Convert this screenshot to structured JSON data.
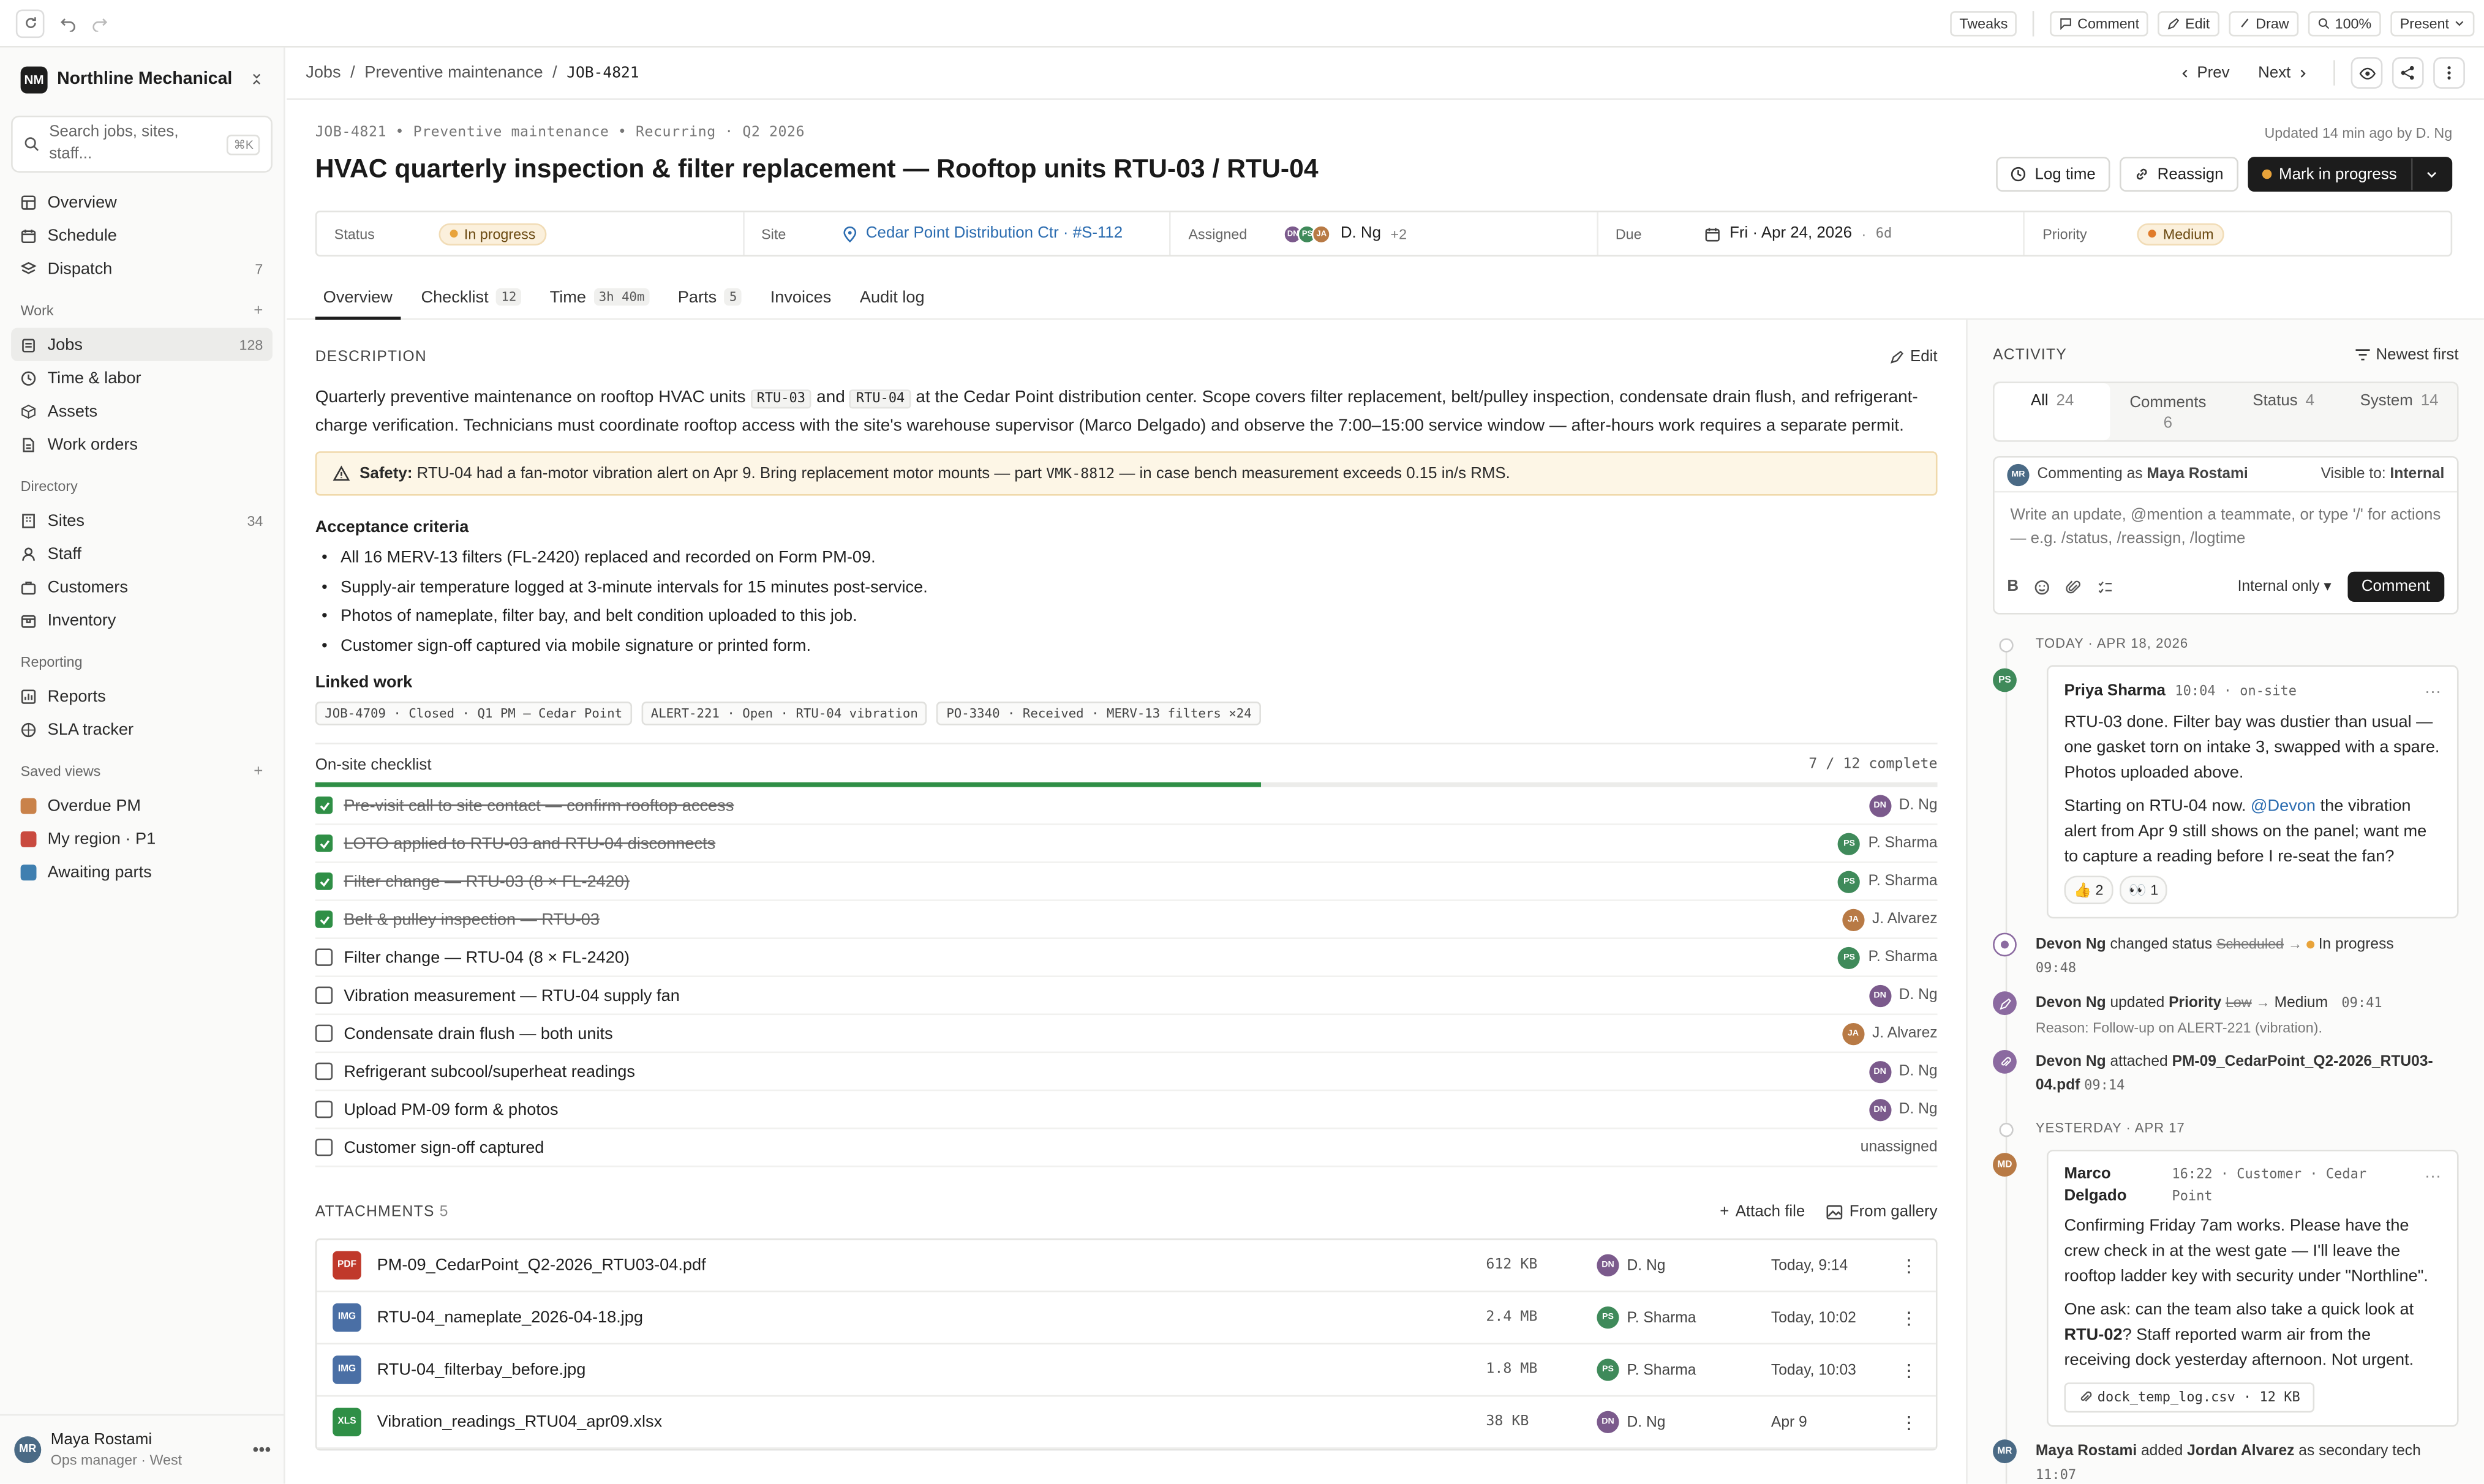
{
  "topbar": {
    "tweaks": "Tweaks",
    "comment": "Comment",
    "edit": "Edit",
    "draw": "Draw",
    "zoom": "100%",
    "present": "Present"
  },
  "sidebar": {
    "org_logo": "NM",
    "org_name": "Northline Mechanical",
    "search_placeholder": "Search jobs, sites, staff...",
    "search_kbd": "⌘K",
    "top_items": [
      {
        "label": "Overview",
        "icon": "grid-icon",
        "count": ""
      },
      {
        "label": "Schedule",
        "icon": "calendar-icon",
        "count": ""
      },
      {
        "label": "Dispatch",
        "icon": "layers-icon",
        "count": "7"
      }
    ],
    "work_label": "Work",
    "work_items": [
      {
        "label": "Jobs",
        "icon": "clipboard-icon",
        "count": "128"
      },
      {
        "label": "Time & labor",
        "icon": "clock-icon",
        "count": ""
      },
      {
        "label": "Assets",
        "icon": "box-icon",
        "count": ""
      },
      {
        "label": "Work orders",
        "icon": "file-icon",
        "count": ""
      }
    ],
    "directory_label": "Directory",
    "directory_items": [
      {
        "label": "Sites",
        "icon": "building-icon",
        "count": "34"
      },
      {
        "label": "Staff",
        "icon": "user-icon",
        "count": ""
      },
      {
        "label": "Customers",
        "icon": "briefcase-icon",
        "count": ""
      },
      {
        "label": "Inventory",
        "icon": "package-icon",
        "count": ""
      }
    ],
    "reporting_label": "Reporting",
    "reporting_items": [
      {
        "label": "Reports",
        "icon": "report-icon",
        "count": ""
      },
      {
        "label": "SLA tracker",
        "icon": "target-icon",
        "count": ""
      }
    ],
    "saved_label": "Saved views",
    "saved_views": [
      {
        "label": "Overdue PM",
        "color": "#c9824a"
      },
      {
        "label": "My region · P1",
        "color": "#c94a3f"
      },
      {
        "label": "Awaiting parts",
        "color": "#3f7fb0"
      }
    ],
    "user": {
      "initials": "MR",
      "name": "Maya Rostami",
      "role": "Ops manager · West"
    }
  },
  "breadcrumb": {
    "jobs": "Jobs",
    "preventive": "Preventive maintenance",
    "current": "JOB-4821",
    "prev": "Prev",
    "next": "Next"
  },
  "job": {
    "meta": "JOB-4821 • Preventive maintenance • Recurring · Q2 2026",
    "updated": "Updated 14 min ago by D. Ng",
    "title": "HVAC quarterly inspection & filter replacement — Rooftop units RTU-03 / RTU-04",
    "log_time": "Log time",
    "reassign": "Reassign",
    "mark": "Mark in progress",
    "props": {
      "status_label": "Status",
      "status_value": "In progress",
      "site_label": "Site",
      "site_value": "Cedar Point Distribution Ctr · #S-112",
      "assigned_label": "Assigned",
      "assigned_value": "D. Ng",
      "assigned_more": "+2",
      "due_label": "Due",
      "due_value": "Fri · Apr 24, 2026",
      "due_rel": "6d",
      "priority_label": "Priority",
      "priority_value": "Medium"
    }
  },
  "tabs": [
    {
      "label": "Overview",
      "count": ""
    },
    {
      "label": "Checklist",
      "count": "12"
    },
    {
      "label": "Time",
      "count": "3h 40m"
    },
    {
      "label": "Parts",
      "count": "5"
    },
    {
      "label": "Invoices",
      "count": ""
    },
    {
      "label": "Audit log",
      "count": ""
    }
  ],
  "description": {
    "heading": "DESCRIPTION",
    "edit": "Edit",
    "p1": "Quarterly preventive maintenance on rooftop HVAC units ",
    "code1": "RTU-03",
    "p2": " and ",
    "code2": "RTU-04",
    "p3": " at the Cedar Point distribution center. Scope covers filter replacement, belt/pulley inspection, condensate drain flush, and refrigerant-charge verification. Technicians must coordinate rooftop access with the site's warehouse supervisor (Marco Delgado) and observe the 7:00–15:00 service window — after-hours work requires a separate permit.",
    "safety_label": "Safety:",
    "safety_text1": " RTU-04 had a fan-motor vibration alert on Apr 9. Bring replacement motor mounts — part ",
    "safety_code": "VMK-8812",
    "safety_text2": " — in case bench measurement exceeds 0.15 in/s RMS."
  },
  "acceptance": {
    "heading": "Acceptance criteria",
    "items": [
      "All 16 MERV-13 filters (FL-2420) replaced and recorded on Form PM-09.",
      "Supply-air temperature logged at 3-minute intervals for 15 minutes post-service.",
      "Photos of nameplate, filter bay, and belt condition uploaded to this job.",
      "Customer sign-off captured via mobile signature or printed form."
    ]
  },
  "linked": {
    "heading": "Linked work",
    "items": [
      "JOB-4709 · Closed · Q1 PM — Cedar Point",
      "ALERT-221 · Open · RTU-04 vibration",
      "PO-3340 · Received · MERV-13 filters ×24"
    ]
  },
  "checklist": {
    "heading": "On-site checklist",
    "summary": "7 / 12 complete",
    "progress": 0.583,
    "rows": [
      {
        "label": "Pre-visit call to site contact — confirm rooftop access",
        "done": true,
        "initials": "DN",
        "who": "D. Ng",
        "color": "#7b5a8c"
      },
      {
        "label": "LOTO applied to RTU-03 and RTU-04 disconnects",
        "done": true,
        "initials": "PS",
        "who": "P. Sharma",
        "color": "#3f8a5a"
      },
      {
        "label": "Filter change — RTU-03 (8 × FL-2420)",
        "done": true,
        "initials": "PS",
        "who": "P. Sharma",
        "color": "#3f8a5a"
      },
      {
        "label": "Belt & pulley inspection — RTU-03",
        "done": true,
        "initials": "JA",
        "who": "J. Alvarez",
        "color": "#b87a45"
      },
      {
        "label": "Filter change — RTU-04 (8 × FL-2420)",
        "done": false,
        "initials": "PS",
        "who": "P. Sharma",
        "color": "#3f8a5a"
      },
      {
        "label": "Vibration measurement — RTU-04 supply fan",
        "done": false,
        "initials": "DN",
        "who": "D. Ng",
        "color": "#7b5a8c"
      },
      {
        "label": "Condensate drain flush — both units",
        "done": false,
        "initials": "JA",
        "who": "J. Alvarez",
        "color": "#b87a45"
      },
      {
        "label": "Refrigerant subcool/superheat readings",
        "done": false,
        "initials": "DN",
        "who": "D. Ng",
        "color": "#7b5a8c"
      },
      {
        "label": "Upload PM-09 form & photos",
        "done": false,
        "initials": "DN",
        "who": "D. Ng",
        "color": "#7b5a8c"
      },
      {
        "label": "Customer sign-off captured",
        "done": false,
        "initials": "",
        "who": "unassigned",
        "color": ""
      }
    ]
  },
  "attachments": {
    "heading": "ATTACHMENTS",
    "count": "5",
    "attach": "Attach file",
    "gallery": "From gallery",
    "rows": [
      {
        "type": "PDF",
        "color": "#c0392b",
        "name": "PM-09_CedarPoint_Q2-2026_RTU03-04.pdf",
        "size": "612 KB",
        "initials": "DN",
        "who": "D. Ng",
        "avcolor": "#7b5a8c",
        "when": "Today, 9:14"
      },
      {
        "type": "IMG",
        "color": "#4a6fa5",
        "name": "RTU-04_nameplate_2026-04-18.jpg",
        "size": "2.4 MB",
        "initials": "PS",
        "who": "P. Sharma",
        "avcolor": "#3f8a5a",
        "when": "Today, 10:02"
      },
      {
        "type": "IMG",
        "color": "#4a6fa5",
        "name": "RTU-04_filterbay_before.jpg",
        "size": "1.8 MB",
        "initials": "PS",
        "who": "P. Sharma",
        "avcolor": "#3f8a5a",
        "when": "Today, 10:03"
      },
      {
        "type": "XLS",
        "color": "#2f8f46",
        "name": "Vibration_readings_RTU04_apr09.xlsx",
        "size": "38 KB",
        "initials": "DN",
        "who": "D. Ng",
        "avcolor": "#7b5a8c",
        "when": "Apr 9"
      }
    ]
  },
  "activity": {
    "heading": "ACTIVITY",
    "sort": "Newest first",
    "tabs": [
      {
        "label": "All",
        "count": "24"
      },
      {
        "label": "Comments",
        "count": "6"
      },
      {
        "label": "Status",
        "count": "4"
      },
      {
        "label": "System",
        "count": "14"
      }
    ],
    "composer": {
      "initials": "MR",
      "as_prefix": "Commenting as",
      "as_name": "Maya Rostami",
      "visible_prefix": "Visible to:",
      "visible_value": "Internal",
      "placeholder": "Write an update, @mention a teammate, or type '/' for actions — e.g. /status, /reassign, /logtime",
      "scope": "Internal only",
      "submit": "Comment"
    },
    "today": "TODAY · APR 18, 2026",
    "c1": {
      "initials": "PS",
      "name": "Priya Sharma",
      "meta": "10:04 · on-site",
      "p1": "RTU-03 done. Filter bay was dustier than usual — one gasket torn on intake 3, swapped with a spare. Photos uploaded above.",
      "p2a": "Starting on RTU-04 now. ",
      "mention": "@Devon",
      "p2b": " the vibration alert from Apr 9 still shows on the panel; want me to capture a reading before I re-seat the fan?",
      "r1": "👍 2",
      "r2": "👀 1"
    },
    "e1": {
      "name": "Devon Ng",
      "verb": "changed status",
      "from": "Scheduled",
      "to": "In progress",
      "time": "09:48"
    },
    "e2": {
      "name": "Devon Ng",
      "verb": "updated",
      "field": "Priority",
      "from": "Low",
      "to": "Medium",
      "time": "09:41",
      "reason": "Reason: Follow-up on ALERT-221 (vibration)."
    },
    "e3": {
      "name": "Devon Ng",
      "verb": "attached",
      "file": "PM-09_CedarPoint_Q2-2026_RTU03-04.pdf",
      "time": "09:14"
    },
    "yesterday": "YESTERDAY · APR 17",
    "c2": {
      "initials": "MD",
      "name": "Marco Delgado",
      "meta": "16:22 · Customer · Cedar Point",
      "p1": "Confirming Friday 7am works. Please have the crew check in at the west gate — I'll leave the rooftop ladder key with security under \"Northline\".",
      "p2a": "One ask: can the team also take a quick look at ",
      "p2b": "RTU-02",
      "p2c": "? Staff reported warm air from the receiving dock yesterday afternoon. Not urgent.",
      "file": "dock_temp_log.csv · 12 KB"
    },
    "e4": {
      "initials": "MR",
      "name": "Maya Rostami",
      "verb": "added",
      "who": "Jordan Alvarez",
      "rest": "as secondary tech",
      "time": "11:07"
    }
  }
}
